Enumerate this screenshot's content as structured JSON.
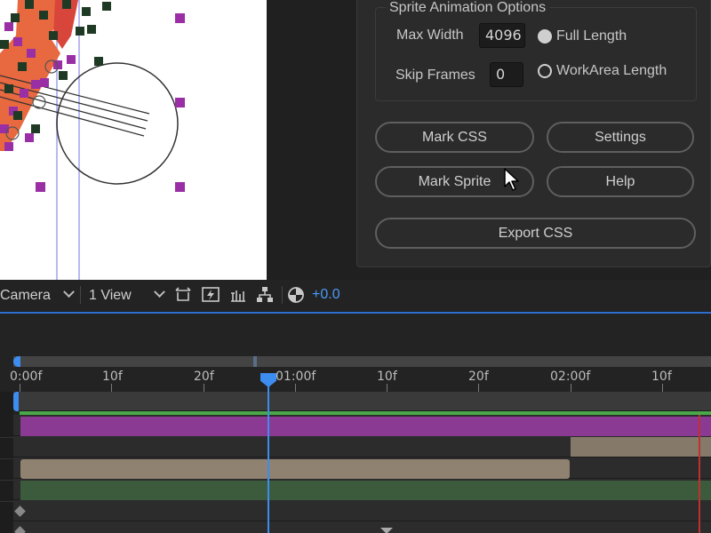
{
  "panel": {
    "group_title": "Sprite Animation Options",
    "max_width_label": "Max Width",
    "max_width_value": "4096",
    "skip_frames_label": "Skip Frames",
    "skip_frames_value": "0",
    "radio_full_length": "Full Length",
    "radio_workarea_length": "WorkArea Length",
    "radio_selected": "full_length",
    "buttons": {
      "mark_css": "Mark CSS",
      "settings": "Settings",
      "mark_sprite": "Mark Sprite",
      "help": "Help",
      "export_css": "Export CSS"
    }
  },
  "toolbar": {
    "camera_select": "Camera",
    "view_select": "1 View",
    "exposure_value": "+0.0"
  },
  "ruler": {
    "labels": [
      "0:00f",
      "10f",
      "20f",
      "01:00f",
      "10f",
      "20f",
      "02:00f",
      "10f"
    ]
  },
  "colors": {
    "accent": "#3d8cf0",
    "layer_purple": "#8b3a94",
    "layer_tan": "#8f8270",
    "layer_green": "#3c5a3c",
    "workarea_green": "#4aa84a"
  }
}
